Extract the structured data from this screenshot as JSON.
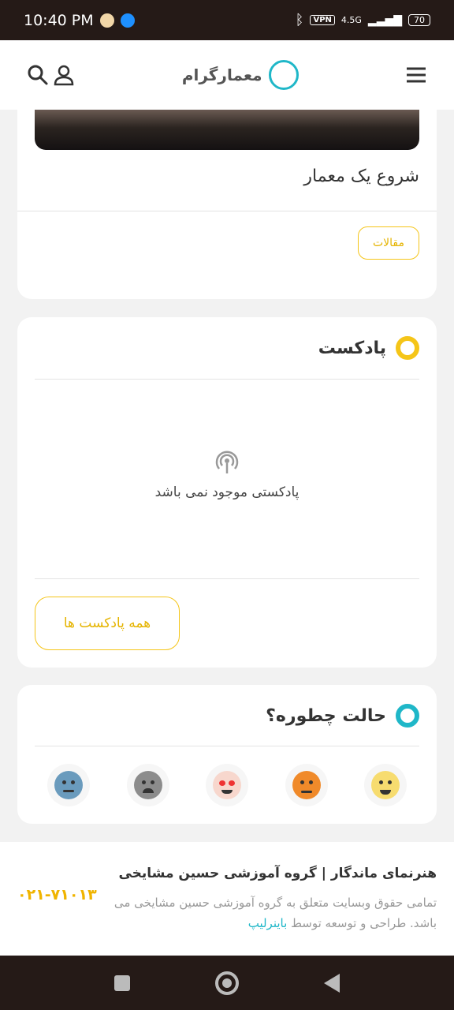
{
  "status": {
    "time": "10:40 PM",
    "vpn": "VPN",
    "network": "4.5G",
    "battery": "70"
  },
  "header": {
    "logo_text": "معمارگرام"
  },
  "article": {
    "title": "شروع یک معمار",
    "tag": "مقالات"
  },
  "podcast": {
    "title": "پادکست",
    "empty_text": "پادکستی موجود نمی باشد",
    "all_button": "همه پادکست ها",
    "bullet_color": "#f5c518"
  },
  "mood": {
    "title": "حالت چطوره؟",
    "bullet_color": "#1fb7c8",
    "faces": [
      "happy-face-icon",
      "angry-face-icon",
      "heart-eyes-face-icon",
      "crying-face-icon",
      "neutral-face-icon"
    ]
  },
  "footer": {
    "title": "هنرنمای ماندگار | گروه آموزشی حسین مشایخی",
    "text": "تمامی حقوق وبسایت متعلق به گروه آموزشی حسین مشایخی می باشد. طراحی و توسعه توسط",
    "link": "باینرلیپ",
    "phone": "۰۲۱-۷۱۰۱۳"
  }
}
